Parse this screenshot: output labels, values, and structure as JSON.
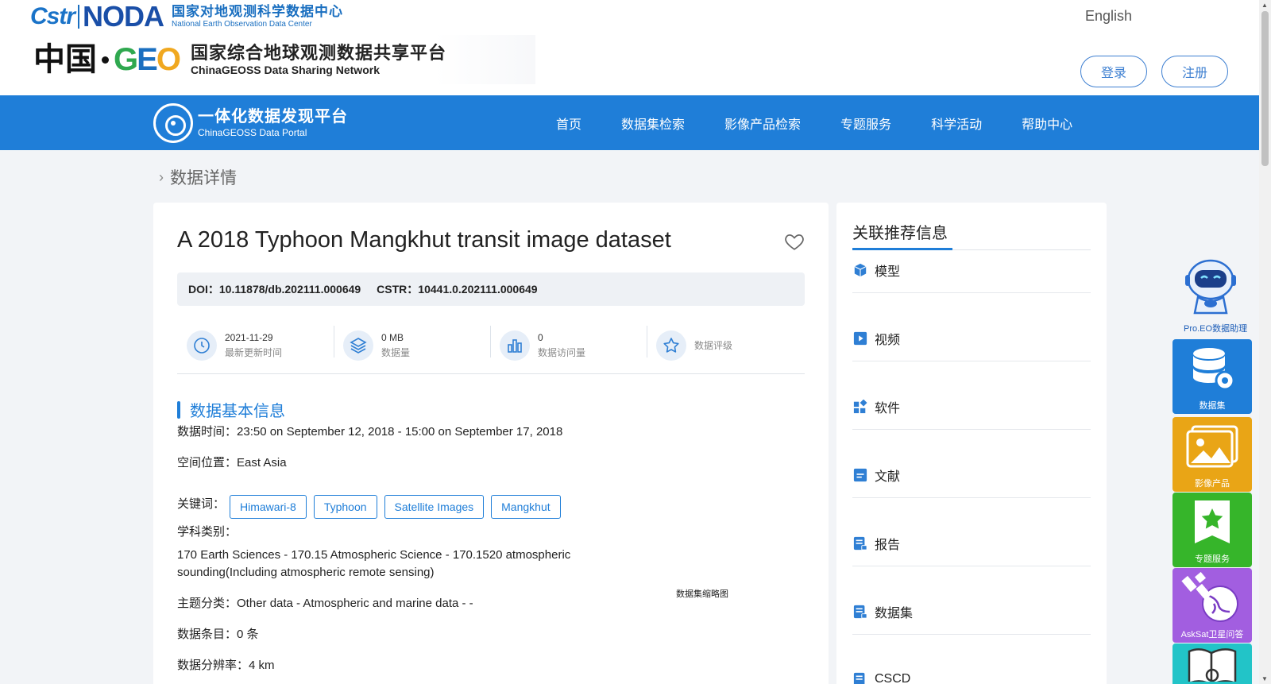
{
  "header": {
    "cstr_logo": "Cstr",
    "noda_logo": "NODA",
    "noda_cn": "国家对地观测科学数据中心",
    "noda_en": "National Earth Observation Data Center",
    "china_cn": "中国",
    "geo_letters": [
      "G",
      "E",
      "O"
    ],
    "geoss_cn": "国家综合地球观测数据共享平台",
    "geoss_en": "ChinaGEOSS Data Sharing Network",
    "language": "English",
    "login": "登录",
    "register": "注册"
  },
  "navbar": {
    "portal_cn": "一体化数据发现平台",
    "portal_en": "ChinaGEOSS Data Portal",
    "items": [
      "首页",
      "数据集检索",
      "影像产品检索",
      "专题服务",
      "科学活动",
      "帮助中心"
    ]
  },
  "breadcrumb": {
    "current": "数据详情"
  },
  "dataset": {
    "title": "A 2018 Typhoon Mangkhut transit image dataset",
    "doi_label": "DOI：",
    "doi": "10.11878/db.202111.000649",
    "cstr_label": "CSTR：",
    "cstr": "10441.0.202111.000649",
    "stats": [
      {
        "icon": "clock-icon",
        "value": "2021-11-29",
        "label": "最新更新时间"
      },
      {
        "icon": "layers-icon",
        "value": "0 MB",
        "label": "数据量"
      },
      {
        "icon": "bar-chart-icon",
        "value": "0",
        "label": "数据访问量"
      },
      {
        "icon": "star-icon",
        "value": "",
        "label": "数据评级"
      }
    ],
    "section_title": "数据基本信息",
    "time_label": "数据时间：",
    "time_value": "23:50 on September 12, 2018 - 15:00 on September 17, 2018",
    "space_label": "空间位置：",
    "space_value": "East Asia",
    "keywords_label": "关键词：",
    "keywords": [
      "Himawari-8",
      "Typhoon",
      "Satellite Images",
      "Mangkhut"
    ],
    "discipline_label": "学科类别：",
    "discipline_line1": "170 Earth Sciences - 170.15 Atmospheric Science - 170.1520 atmospheric",
    "discipline_line2": "sounding(Including atmospheric remote sensing)",
    "theme_label": "主题分类：",
    "theme_value": "Other data - Atmospheric and marine data - -",
    "entries_label": "数据条目：",
    "entries_value": "0 条",
    "resolution_label": "数据分辨率：",
    "resolution_value": "4 km",
    "thumbnail_caption": "数据集缩略图"
  },
  "side": {
    "title": "关联推荐信息",
    "items": [
      {
        "icon": "cube-icon",
        "label": "模型"
      },
      {
        "icon": "video-icon",
        "label": "视频"
      },
      {
        "icon": "grid-icon",
        "label": "软件"
      },
      {
        "icon": "document-icon",
        "label": "文献"
      },
      {
        "icon": "report-icon",
        "label": "报告"
      },
      {
        "icon": "dataset-icon",
        "label": "数据集"
      },
      {
        "icon": "journal-icon",
        "label": "CSCD"
      }
    ]
  },
  "tools": {
    "assistant_label": "Pro.EO数据助理",
    "buttons": [
      {
        "label": "数据集",
        "color": "#1f7ed8",
        "icon": "database-gear-icon"
      },
      {
        "label": "影像产品",
        "color": "#e9a516",
        "icon": "image-icon"
      },
      {
        "label": "专题服务",
        "color": "#36b52a",
        "icon": "bookmark-star-icon"
      },
      {
        "label": "AskSat卫星问答",
        "color": "#a25ee0",
        "icon": "satellite-globe-icon"
      },
      {
        "label": "",
        "color": "#22c4c8",
        "icon": "book-icon"
      }
    ]
  },
  "colors": {
    "primary": "#1f7ed8",
    "background": "#f2f4f7"
  }
}
